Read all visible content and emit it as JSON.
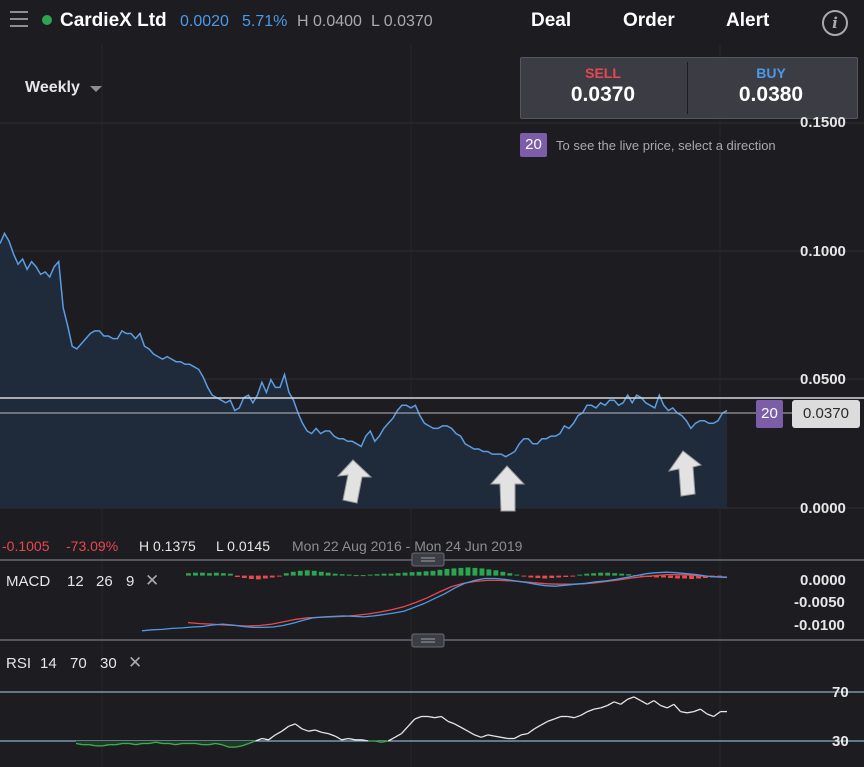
{
  "header": {
    "instrument": "CardieX Ltd",
    "change": "0.0020",
    "change_pct": "5.71%",
    "high": "H 0.0400",
    "low": "L 0.0370",
    "nav": [
      "Deal",
      "Order",
      "Alert"
    ],
    "info_icon": "info-icon",
    "menu_icon": "hamburger-menu-icon"
  },
  "timeframe": "Weekly",
  "deal": {
    "sell_label": "SELL",
    "sell_price": "0.0370",
    "buy_label": "BUY",
    "buy_price": "0.0380",
    "badge": "20",
    "hint": "To see the live price, select a direction"
  },
  "price_tag": "0.0370",
  "last_badge": "20",
  "stats": {
    "change": "-0.1005",
    "change_pct": "-73.09%",
    "high": "H 0.1375",
    "low": "L 0.0145",
    "range": "Mon 22 Aug 2016 - Mon 24 Jun 2019"
  },
  "macd": {
    "label": "MACD",
    "params": [
      "12",
      "26",
      "9"
    ],
    "ticks": [
      "0.0000",
      "-0.0050",
      "-0.0100"
    ]
  },
  "rsi": {
    "label": "RSI",
    "params": [
      "14",
      "70",
      "30"
    ],
    "ticks": [
      "70",
      "30"
    ]
  },
  "colors": {
    "accent_blue": "#4a9ae8",
    "sell_red": "#e8474f",
    "up_green": "#2da44e",
    "badge_purple": "#7b5ea7",
    "signal_red": "#e84a4a"
  },
  "chart_data": {
    "type": "area",
    "x_range": [
      "Mon 22 Aug 2016",
      "Mon 24 Jun 2019"
    ],
    "y_ticks": [
      "0.1500",
      "0.1000",
      "0.0500",
      "0.0000"
    ],
    "ylim": [
      0,
      0.15
    ],
    "horizontal_line": 0.0445,
    "current_price": 0.037,
    "annotations": [
      "up-arrow",
      "up-arrow",
      "up-arrow"
    ],
    "series": [
      {
        "values": [
          0.103,
          0.107,
          0.104,
          0.099,
          0.095,
          0.097,
          0.093,
          0.096,
          0.094,
          0.091,
          0.092,
          0.09,
          0.094,
          0.096,
          0.078,
          0.071,
          0.063,
          0.062,
          0.064,
          0.066,
          0.068,
          0.069,
          0.069,
          0.067,
          0.067,
          0.066,
          0.066,
          0.069,
          0.068,
          0.068,
          0.066,
          0.068,
          0.063,
          0.062,
          0.06,
          0.059,
          0.058,
          0.059,
          0.058,
          0.057,
          0.057,
          0.056,
          0.056,
          0.055,
          0.054,
          0.051,
          0.047,
          0.044,
          0.043,
          0.042,
          0.041,
          0.042,
          0.038,
          0.039,
          0.043,
          0.044,
          0.041,
          0.044,
          0.049,
          0.045,
          0.05,
          0.047,
          0.047,
          0.052,
          0.045,
          0.042,
          0.037,
          0.033,
          0.03,
          0.029,
          0.031,
          0.029,
          0.03,
          0.03,
          0.028,
          0.027,
          0.027,
          0.026,
          0.026,
          0.025,
          0.024,
          0.028,
          0.03,
          0.026,
          0.028,
          0.031,
          0.033,
          0.035,
          0.038,
          0.04,
          0.04,
          0.039,
          0.04,
          0.036,
          0.033,
          0.032,
          0.031,
          0.031,
          0.032,
          0.032,
          0.031,
          0.029,
          0.028,
          0.025,
          0.024,
          0.023,
          0.023,
          0.022,
          0.022,
          0.021,
          0.021,
          0.021,
          0.02,
          0.021,
          0.022,
          0.025,
          0.027,
          0.027,
          0.025,
          0.025,
          0.027,
          0.027,
          0.028,
          0.028,
          0.029,
          0.032,
          0.031,
          0.033,
          0.036,
          0.037,
          0.04,
          0.04,
          0.039,
          0.041,
          0.04,
          0.042,
          0.042,
          0.04,
          0.041,
          0.044,
          0.041,
          0.044,
          0.043,
          0.041,
          0.04,
          0.039,
          0.044,
          0.04,
          0.038,
          0.039,
          0.037,
          0.036,
          0.034,
          0.031,
          0.033,
          0.034,
          0.034,
          0.033,
          0.033,
          0.034,
          0.037,
          0.038
        ]
      }
    ],
    "macd_panel": {
      "ylim": [
        -0.013,
        0.002
      ],
      "macd_line": [
        -0.0115,
        -0.0113,
        -0.0112,
        -0.011,
        -0.0109,
        -0.0107,
        -0.0106,
        -0.0103,
        -0.0101,
        -0.0103,
        -0.0106,
        -0.0108,
        -0.0108,
        -0.0107,
        -0.0104,
        -0.0099,
        -0.0093,
        -0.0088,
        -0.0086,
        -0.0085,
        -0.0084,
        -0.0085,
        -0.0086,
        -0.0084,
        -0.0081,
        -0.0078,
        -0.0074,
        -0.0066,
        -0.0058,
        -0.0048,
        -0.0038,
        -0.0026,
        -0.0016,
        -0.001,
        -0.0006,
        -0.0006,
        -0.0008,
        -0.0011,
        -0.0014,
        -0.0018,
        -0.0021,
        -0.0022,
        -0.002,
        -0.0018,
        -0.0016,
        -0.0013,
        -0.0011,
        -0.0008,
        -0.0004,
        0.0,
        0.0004,
        0.0006,
        0.0007,
        0.0006,
        0.0004,
        0.0002,
        -0.0001,
        -0.0003,
        -0.0004
      ],
      "signal_line": [
        -0.0098,
        -0.01,
        -0.0101,
        -0.0103,
        -0.0104,
        -0.0105,
        -0.0104,
        -0.0101,
        -0.0096,
        -0.0091,
        -0.0088,
        -0.0087,
        -0.0086,
        -0.0085,
        -0.0083,
        -0.008,
        -0.0076,
        -0.0071,
        -0.0065,
        -0.0056,
        -0.0046,
        -0.0034,
        -0.0023,
        -0.0016,
        -0.0012,
        -0.001,
        -0.001,
        -0.0011,
        -0.0013,
        -0.0015,
        -0.0017,
        -0.0018,
        -0.0018,
        -0.0017,
        -0.0015,
        -0.0012,
        -0.0009,
        -0.0005,
        -0.0002,
        0.0,
        0.0002,
        0.0002,
        0.0001,
        -0.0001,
        -0.0002,
        -0.0003
      ],
      "histogram": [
        0.0005,
        0.0006,
        0.0006,
        0.0005,
        0.0006,
        0.0005,
        0.0004,
        -0.0003,
        -0.0005,
        -0.0007,
        -0.0008,
        -0.0006,
        -0.0004,
        -0.0002,
        0.0005,
        0.0008,
        0.001,
        0.0011,
        0.001,
        0.0008,
        0.0006,
        0.0004,
        0.0003,
        0.0002,
        0.0001,
        0.0001,
        0.0002,
        0.0003,
        0.0004,
        0.0004,
        0.0005,
        0.0006,
        0.0007,
        0.0008,
        0.0009,
        0.001,
        0.0012,
        0.0014,
        0.0015,
        0.0016,
        0.0017,
        0.0016,
        0.0015,
        0.0013,
        0.0011,
        0.0008,
        0.0005,
        0.0002,
        -0.0002,
        -0.0004,
        -0.0005,
        -0.0006,
        -0.0005,
        -0.0004,
        -0.0003,
        -0.0002,
        0.0002,
        0.0004,
        0.0005,
        0.0006,
        0.0006,
        0.0005,
        0.0004,
        0.0003,
        0.0001,
        -0.0002,
        -0.0003,
        -0.0004,
        -0.0004,
        -0.0005,
        -0.0006,
        -0.0006,
        -0.0007,
        -0.0006,
        -0.0005,
        -0.0004,
        -0.0003
      ]
    },
    "rsi_panel": {
      "ylim": [
        25,
        75
      ],
      "levels": [
        70,
        30
      ],
      "values": [
        28,
        27,
        27,
        26,
        26,
        27,
        27,
        28,
        28,
        27,
        28,
        28,
        29,
        28,
        28,
        27,
        28,
        28,
        28,
        27,
        27,
        28,
        27,
        25,
        25,
        26,
        28,
        30,
        32,
        31,
        35,
        38,
        42,
        44,
        40,
        38,
        39,
        37,
        36,
        34,
        31,
        32,
        31,
        31,
        30,
        30,
        29,
        30,
        33,
        36,
        42,
        48,
        50,
        50,
        49,
        50,
        46,
        44,
        41,
        38,
        35,
        33,
        35,
        34,
        33,
        32,
        32,
        35,
        36,
        40,
        43,
        46,
        48,
        50,
        50,
        49,
        51,
        54,
        56,
        57,
        59,
        62,
        60,
        64,
        66,
        63,
        60,
        63,
        59,
        57,
        60,
        54,
        53,
        54,
        56,
        52,
        50,
        54,
        54
      ]
    }
  }
}
